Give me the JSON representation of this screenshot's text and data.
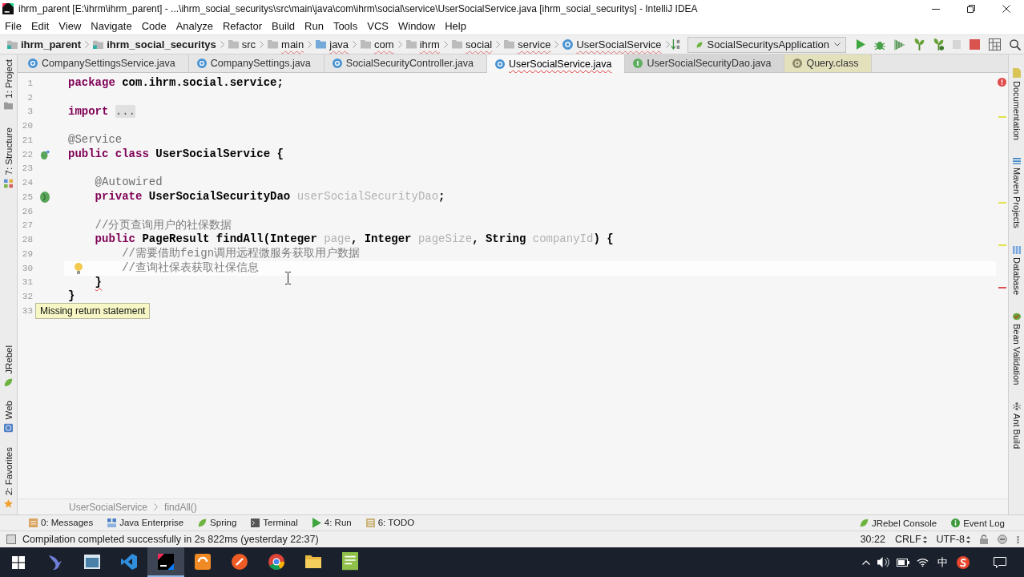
{
  "window": {
    "title": "ihrm_parent [E:\\ihrm\\ihrm_parent] - ...\\ihrm_social_securitys\\src\\main\\java\\com\\ihrm\\social\\service\\UserSocialService.java [ihrm_social_securitys] - IntelliJ IDEA"
  },
  "menu": [
    "File",
    "Edit",
    "View",
    "Navigate",
    "Code",
    "Analyze",
    "Refactor",
    "Build",
    "Run",
    "Tools",
    "VCS",
    "Window",
    "Help"
  ],
  "navigation_bar": {
    "breadcrumbs": [
      {
        "label": "ihrm_parent",
        "kind": "module",
        "error": false
      },
      {
        "label": "ihrm_social_securitys",
        "kind": "module",
        "error": false
      },
      {
        "label": "src",
        "kind": "folder",
        "error": false
      },
      {
        "label": "main",
        "kind": "folder",
        "error": true
      },
      {
        "label": "java",
        "kind": "source",
        "error": true
      },
      {
        "label": "com",
        "kind": "folder",
        "error": true
      },
      {
        "label": "ihrm",
        "kind": "folder",
        "error": true
      },
      {
        "label": "social",
        "kind": "folder",
        "error": true
      },
      {
        "label": "service",
        "kind": "folder",
        "error": true
      },
      {
        "label": "UserSocialService",
        "kind": "class",
        "error": true
      }
    ],
    "run_configuration": "SocialSecuritysApplication"
  },
  "tabs": [
    {
      "label": "CompanySettingsService.java",
      "kind": "class",
      "selected": false,
      "error": false,
      "color": "#e6e6e6"
    },
    {
      "label": "CompanySettings.java",
      "kind": "class",
      "selected": false,
      "error": false,
      "color": "#e6e6e6"
    },
    {
      "label": "SocialSecurityController.java",
      "kind": "class",
      "selected": false,
      "error": false,
      "color": "#e6e6e6"
    },
    {
      "label": "UserSocialService.java",
      "kind": "class",
      "selected": true,
      "error": true,
      "color": "#f7f7f7"
    },
    {
      "label": "UserSocialSecurityDao.java",
      "kind": "interface",
      "selected": false,
      "error": false,
      "color": "#d5d5d5"
    },
    {
      "label": "Query.class",
      "kind": "compiled",
      "selected": false,
      "error": false,
      "color": "#e3e0bc"
    }
  ],
  "left_tool_strip": {
    "top": [
      "1: Project",
      "7: Structure"
    ],
    "bottom": [
      "JRebel",
      "Web",
      "2: Favorites"
    ]
  },
  "right_tool_strip": [
    "Documentation",
    "Maven Projects",
    "Database",
    "Bean Validation",
    "Ant Build"
  ],
  "editor": {
    "lines": [
      {
        "number": "1",
        "current": false,
        "bulb": false,
        "tokens": [
          {
            "kind": "keyword",
            "text": "package"
          },
          {
            "kind": "plain",
            "text": " com.ihrm.social.service;"
          }
        ]
      },
      {
        "number": "2",
        "current": false,
        "bulb": false
      },
      {
        "number": "3",
        "current": false,
        "bulb": false,
        "stripe": {
          "kind": "warning"
        },
        "tokens": [
          {
            "kind": "keyword",
            "text": "import "
          },
          {
            "kind": "fold",
            "text": "..."
          }
        ]
      },
      {
        "number": "20",
        "current": false,
        "bulb": false
      },
      {
        "number": "21",
        "current": false,
        "bulb": false,
        "tokens": [
          {
            "kind": "annotation",
            "text": "@Service"
          }
        ]
      },
      {
        "number": "22",
        "current": false,
        "bulb": false,
        "gutter_marker": {
          "kind": "bean_class"
        },
        "tokens": [
          {
            "kind": "keyword",
            "text": "public class"
          },
          {
            "kind": "plain",
            "text": " UserSocialService {"
          }
        ]
      },
      {
        "number": "23",
        "current": false,
        "bulb": false
      },
      {
        "number": "24",
        "current": false,
        "bulb": false,
        "tokens": [
          {
            "kind": "annotation",
            "text": "    @Autowired"
          }
        ]
      },
      {
        "number": "25",
        "current": false,
        "bulb": false,
        "stripe": {
          "kind": "warning"
        },
        "gutter_marker": {
          "kind": "bean_injection"
        },
        "tokens": [
          {
            "kind": "keyword",
            "text": "    private"
          },
          {
            "kind": "plain",
            "text": " UserSocialSecurityDao "
          },
          {
            "kind": "unused",
            "text": "userSocialSecurityDao"
          },
          {
            "kind": "plain",
            "text": ";"
          }
        ]
      },
      {
        "number": "26",
        "current": false,
        "bulb": false
      },
      {
        "number": "27",
        "current": false,
        "bulb": false,
        "tokens": [
          {
            "kind": "comment",
            "text": "    //分页查询用户的社保数据"
          }
        ]
      },
      {
        "number": "28",
        "current": false,
        "bulb": false,
        "stripe": {
          "kind": "warning"
        },
        "tokens": [
          {
            "kind": "keyword",
            "text": "    public"
          },
          {
            "kind": "plain",
            "text": " PageResult findAll(Integer "
          },
          {
            "kind": "unused",
            "text": "page"
          },
          {
            "kind": "plain",
            "text": ", Integer "
          },
          {
            "kind": "unused",
            "text": "pageSize"
          },
          {
            "kind": "plain",
            "text": ", String "
          },
          {
            "kind": "unused",
            "text": "companyId"
          },
          {
            "kind": "plain",
            "text": ") {"
          }
        ]
      },
      {
        "number": "29",
        "current": false,
        "bulb": false,
        "tokens": [
          {
            "kind": "comment",
            "text": "        //需要借助feign调用远程微服务获取用户数据"
          }
        ]
      },
      {
        "number": "30",
        "current": true,
        "bulb": true,
        "tokens": [
          {
            "kind": "comment",
            "text": "        //查询社保表获取社保信息"
          }
        ]
      },
      {
        "number": "31",
        "current": false,
        "bulb": false,
        "stripe": {
          "kind": "error"
        },
        "tokens": [
          {
            "kind": "error",
            "text": "    }"
          }
        ]
      },
      {
        "number": "32",
        "current": false,
        "bulb": false,
        "tokens": [
          {
            "kind": "plain",
            "text": "}"
          }
        ]
      },
      {
        "number": "33",
        "current": false,
        "bulb": false
      }
    ],
    "tooltip": "Missing return statement",
    "breadcrumbs": [
      "UserSocialService",
      "findAll()"
    ]
  },
  "tool_windows": {
    "left": [
      "0: Messages",
      "Java Enterprise",
      "Spring",
      "Terminal",
      "4: Run",
      "6: TODO"
    ],
    "right": [
      "JRebel Console",
      "Event Log"
    ]
  },
  "status_bar": {
    "message": "Compilation completed successfully in 2s 822ms (yesterday 22:37)",
    "caret_position": "30:22",
    "line_separator": "CRLF",
    "encoding": "UTF-8"
  },
  "taskbar": {
    "apps": [
      {
        "selected": false
      },
      {
        "selected": false
      },
      {
        "selected": false
      },
      {
        "selected": true
      },
      {
        "selected": false
      },
      {
        "selected": false
      },
      {
        "selected": false
      },
      {
        "selected": false
      },
      {
        "selected": false
      }
    ],
    "input_language": "中"
  }
}
